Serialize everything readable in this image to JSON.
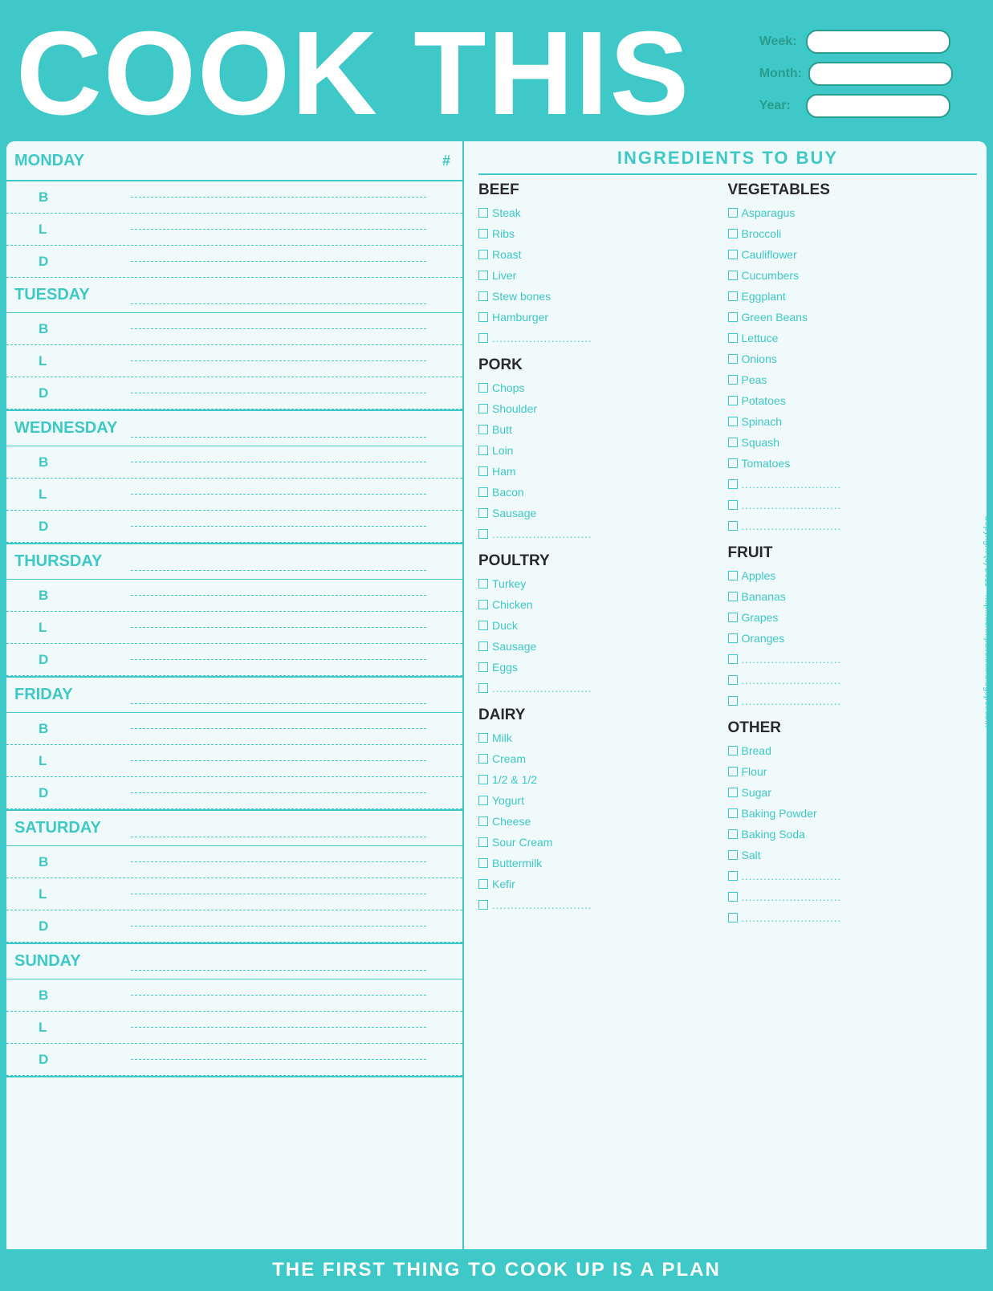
{
  "header": {
    "title": "COOK THIS",
    "week_label": "Week:",
    "month_label": "Month:",
    "year_label": "Year:"
  },
  "planner": {
    "hash_symbol": "#",
    "days": [
      {
        "name": "MONDAY",
        "meals": [
          {
            "letter": "B"
          },
          {
            "letter": "L"
          },
          {
            "letter": "D"
          }
        ]
      },
      {
        "name": "TUESDAY",
        "meals": [
          {
            "letter": "B"
          },
          {
            "letter": "L"
          },
          {
            "letter": "D"
          }
        ]
      },
      {
        "name": "WEDNESDAY",
        "meals": [
          {
            "letter": "B"
          },
          {
            "letter": "L"
          },
          {
            "letter": "D"
          }
        ]
      },
      {
        "name": "THURSDAY",
        "meals": [
          {
            "letter": "B"
          },
          {
            "letter": "L"
          },
          {
            "letter": "D"
          }
        ]
      },
      {
        "name": "FRIDAY",
        "meals": [
          {
            "letter": "B"
          },
          {
            "letter": "L"
          },
          {
            "letter": "D"
          }
        ]
      },
      {
        "name": "SATURDAY",
        "meals": [
          {
            "letter": "B"
          },
          {
            "letter": "L"
          },
          {
            "letter": "D"
          }
        ]
      },
      {
        "name": "SUNDAY",
        "meals": [
          {
            "letter": "B"
          },
          {
            "letter": "L"
          },
          {
            "letter": "D"
          }
        ]
      }
    ]
  },
  "ingredients": {
    "header": "INGREDIENTS TO BUY",
    "col1": {
      "sections": [
        {
          "title": "BEEF",
          "items": [
            "Steak",
            "Ribs",
            "Roast",
            "Liver",
            "Stew bones",
            "Hamburger"
          ],
          "blanks": 1
        },
        {
          "title": "PORK",
          "items": [
            "Chops",
            "Shoulder",
            "Butt",
            "Loin",
            "Ham",
            "Bacon",
            "Sausage"
          ],
          "blanks": 1
        },
        {
          "title": "POULTRY",
          "items": [
            "Turkey",
            "Chicken",
            "Duck",
            "Sausage",
            "Eggs"
          ],
          "blanks": 1
        },
        {
          "title": "DAIRY",
          "items": [
            "Milk",
            "Cream",
            "1/2 & 1/2",
            "Yogurt",
            "Cheese",
            "Sour Cream",
            "Buttermilk",
            "Kefir"
          ],
          "blanks": 1
        }
      ]
    },
    "col2": {
      "sections": [
        {
          "title": "VEGETABLES",
          "items": [
            "Asparagus",
            "Broccoli",
            "Cauliflower",
            "Cucumbers",
            "Eggplant",
            "Green Beans",
            "Lettuce",
            "Onions",
            "Peas",
            "Potatoes",
            "Spinach",
            "Squash",
            "Tomatoes"
          ],
          "blanks": 3
        },
        {
          "title": "FRUIT",
          "items": [
            "Apples",
            "Bananas",
            "Grapes",
            "Oranges"
          ],
          "blanks": 3
        },
        {
          "title": "OTHER",
          "items": [
            "Bread",
            "Flour",
            "Sugar",
            "Baking Powder",
            "Baking Soda",
            "Salt"
          ],
          "blanks": 3
        }
      ]
    }
  },
  "footer": {
    "text": "THE FIRST THING TO COOK UP IS A PLAN"
  },
  "side_text": "Copyright (c) 2011  -  http://scrimpalicious.blogspot.com"
}
